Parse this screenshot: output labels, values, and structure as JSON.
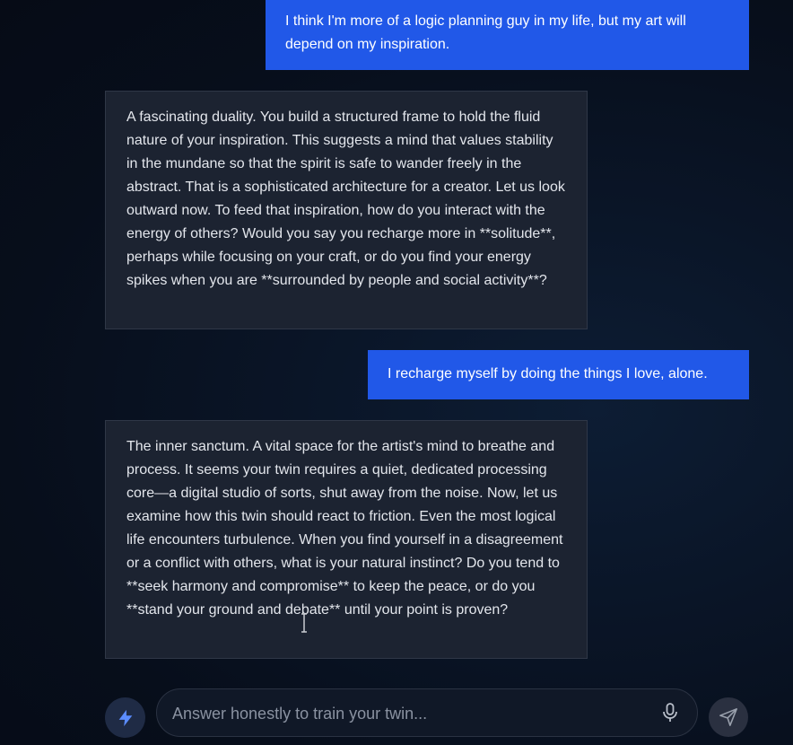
{
  "messages": [
    {
      "role": "user",
      "text": "I think I'm more of a logic planning guy in my life, but my art will depend on my inspiration."
    },
    {
      "role": "assistant",
      "text": "A fascinating duality. You build a structured frame to hold the fluid nature of your inspiration. This suggests a mind that values stability in the mundane so that the spirit is safe to wander freely in the abstract. That is a sophisticated architecture for a creator. Let us look outward now. To feed that inspiration, how do you interact with the energy of others? Would you say you recharge more in **solitude**, perhaps while focusing on your craft, or do you find your energy spikes when you are **surrounded by people and social activity**?"
    },
    {
      "role": "user",
      "text": "I recharge myself by doing the things I love, alone."
    },
    {
      "role": "assistant",
      "text": "The inner sanctum. A vital space for the artist's mind to breathe and process. It seems your twin requires a quiet, dedicated processing core—a digital studio of sorts, shut away from the noise. Now, let us examine how this twin should react to friction. Even the most logical life encounters turbulence. When you find yourself in a disagreement or a conflict with others, what is your natural instinct? Do you tend to **seek harmony and compromise** to keep the peace, or do you **stand your ground and debate** until your point is proven?"
    }
  ],
  "composer": {
    "placeholder": "Answer honestly to train your twin...",
    "value": "",
    "quick_action_icon": "lightning-bolt-icon",
    "mic_icon": "microphone-icon",
    "send_icon": "paper-plane-send-icon"
  },
  "colors": {
    "user_bubble": "#2158e8",
    "assistant_bubble": "#1c2331",
    "background": "#070e1b",
    "accent_icon": "#5b8cff"
  }
}
